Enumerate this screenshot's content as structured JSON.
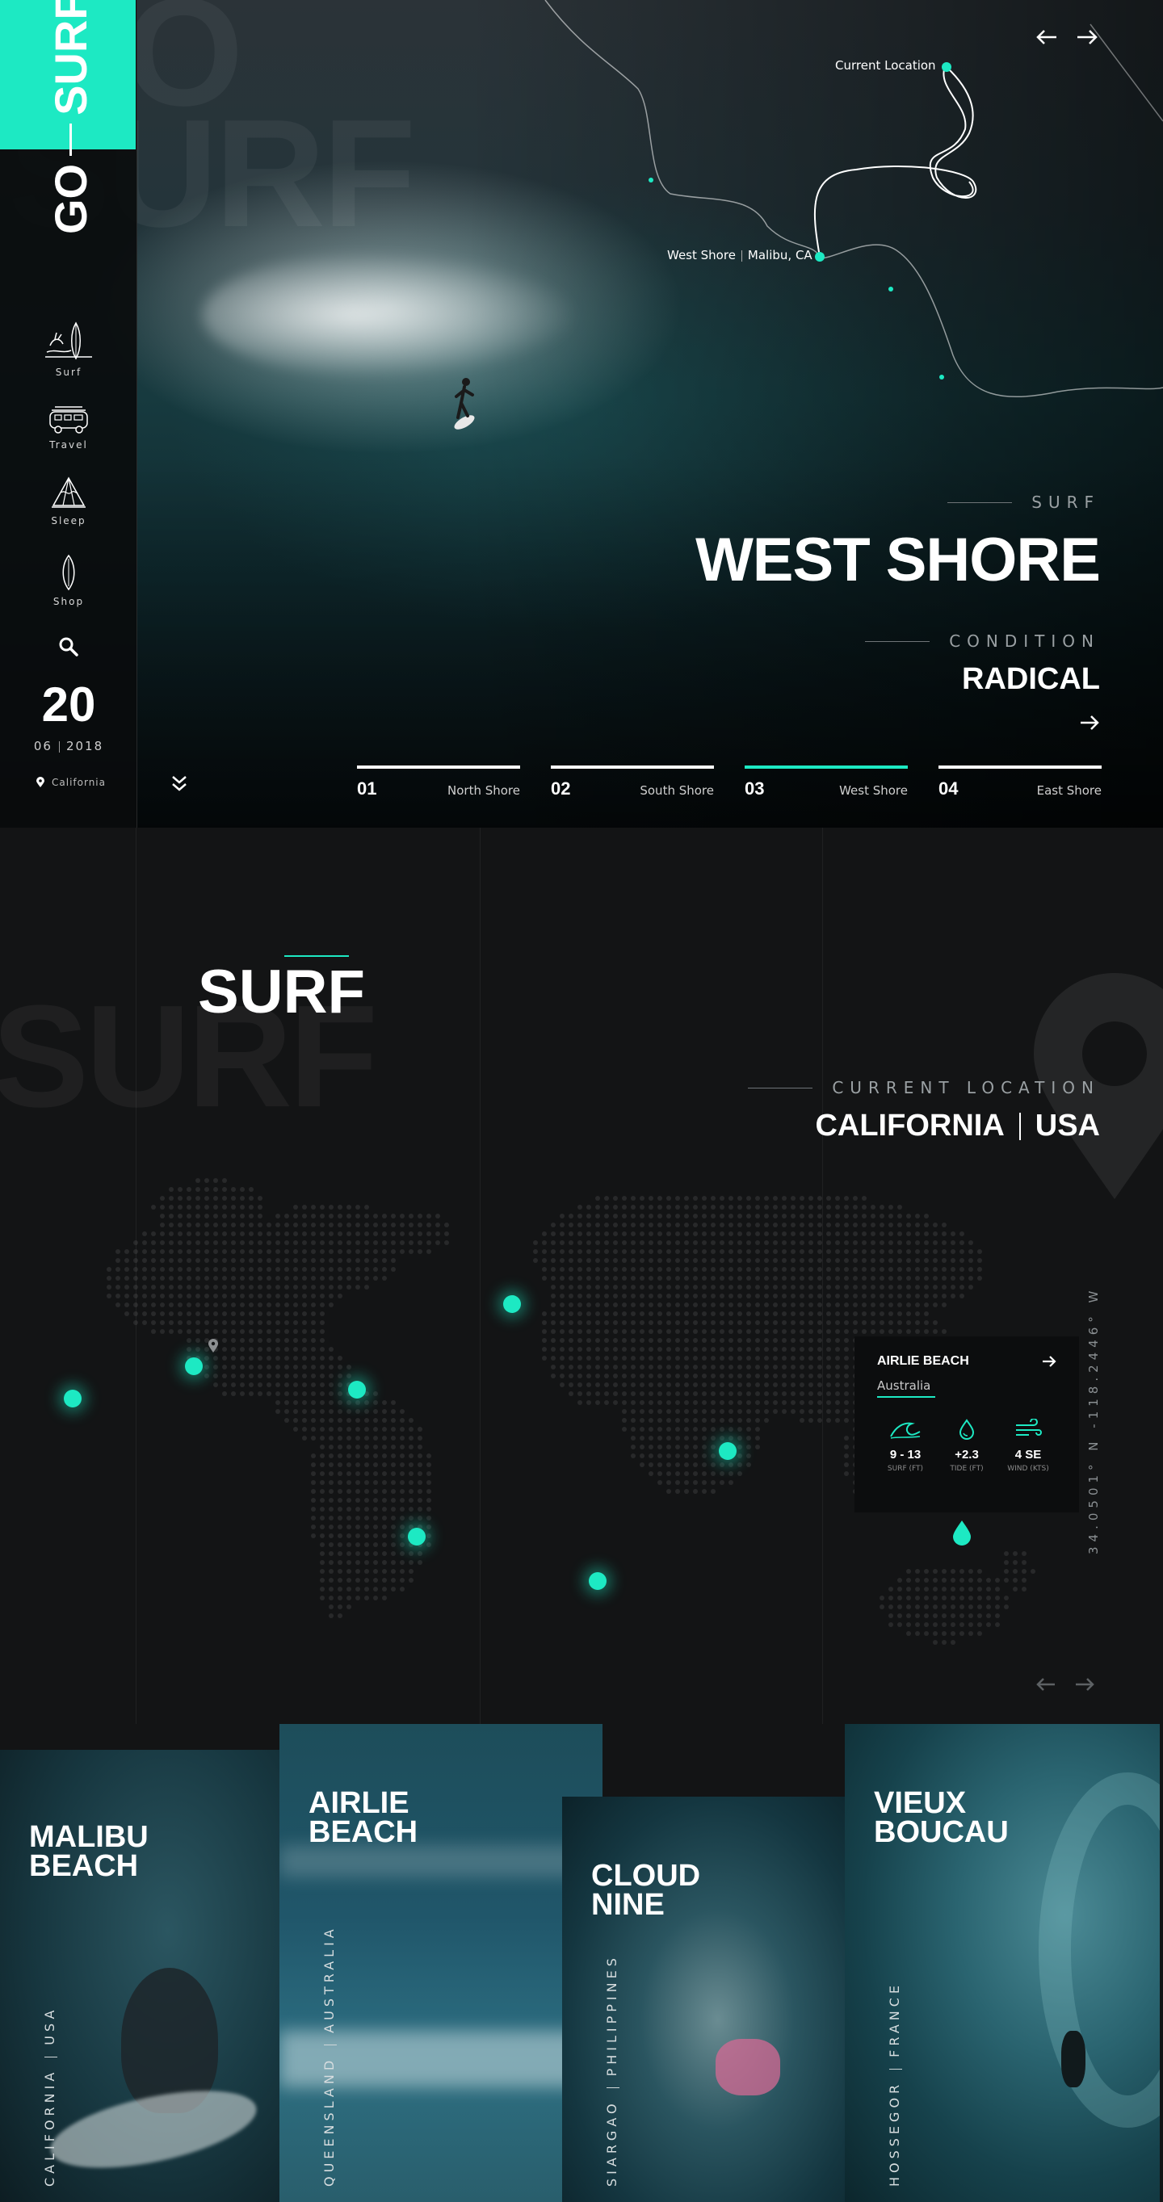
{
  "brand": {
    "go": "GO",
    "surf": "SURF",
    "bg_text": "GO\nSURF"
  },
  "nav": [
    {
      "label": "Surf",
      "icon": "surfboards-icon"
    },
    {
      "label": "Travel",
      "icon": "van-icon"
    },
    {
      "label": "Sleep",
      "icon": "tent-icon"
    },
    {
      "label": "Shop",
      "icon": "surfboard-icon"
    }
  ],
  "date": {
    "day": "20",
    "month": "06",
    "year": "2018"
  },
  "place": "California",
  "map_labels": {
    "current": "Current Location",
    "west": "West Shore",
    "west_city": "Malibu, CA"
  },
  "hero": {
    "kicker": "SURF",
    "title": "WEST SHORE",
    "condition_label": "CONDITION",
    "condition_value": "RADICAL"
  },
  "slides": [
    {
      "num": "01",
      "name": "North Shore",
      "active": false
    },
    {
      "num": "02",
      "name": "South Shore",
      "active": false
    },
    {
      "num": "03",
      "name": "West Shore",
      "active": true
    },
    {
      "num": "04",
      "name": "East Shore",
      "active": false
    }
  ],
  "map_section": {
    "bg_text": "SURF",
    "title": "SURF",
    "loc_label": "CURRENT LOCATION",
    "loc_state": "CALIFORNIA",
    "loc_country": "USA",
    "coords": "34.0501° N -118.2446° W"
  },
  "spot_card": {
    "name": "AIRLIE BEACH",
    "country": "Australia",
    "stats": [
      {
        "value": "9 - 13",
        "label": "SURF (FT)",
        "icon": "wave-icon"
      },
      {
        "value": "+2.3",
        "label": "TIDE (FT)",
        "icon": "drop-icon"
      },
      {
        "value": "4 SE",
        "label": "WIND (KTS)",
        "icon": "wind-icon"
      }
    ]
  },
  "cards": [
    {
      "title": "MALIBU\nBEACH",
      "place": "CALIFORNIA",
      "country": "USA"
    },
    {
      "title": "AIRLIE\nBEACH",
      "place": "QUEENSLAND",
      "country": "AUSTRALIA"
    },
    {
      "title": "CLOUD\nNINE",
      "place": "SIARGAO",
      "country": "PHILIPPINES"
    },
    {
      "title": "VIEUX\nBOUCAU",
      "place": "HOSSEGOR",
      "country": "FRANCE"
    }
  ],
  "colors": {
    "accent": "#1de9c3",
    "bg": "#131415"
  }
}
